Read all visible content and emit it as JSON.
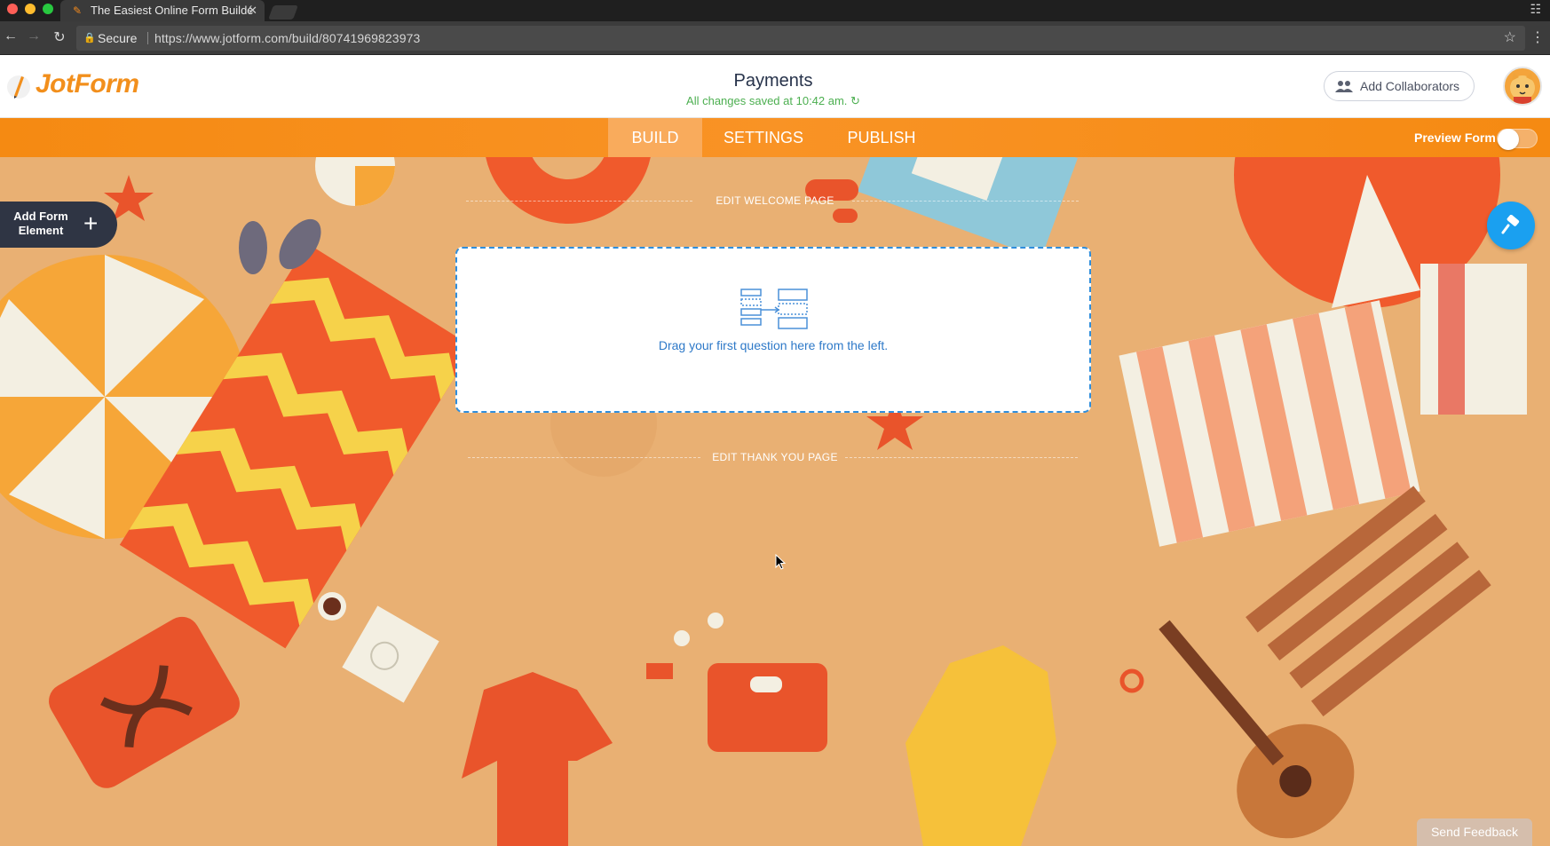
{
  "browser": {
    "tab_title": "The Easiest Online Form Buildé",
    "tab_close": "✕",
    "secure_label": "Secure",
    "url": "https://www.jotform.com/build/80741969823973"
  },
  "header": {
    "logo_text": "JotForm",
    "form_title": "Payments",
    "save_status": "All changes saved at 10:42 am.",
    "collaborators_button": "Add Collaborators"
  },
  "toolbar": {
    "tabs": [
      {
        "label": "BUILD",
        "active": true
      },
      {
        "label": "SETTINGS",
        "active": false
      },
      {
        "label": "PUBLISH",
        "active": false
      }
    ],
    "preview_label": "Preview Form",
    "preview_enabled": false
  },
  "builder": {
    "add_element_label": "Add Form Element",
    "add_element_icon": "+",
    "edit_welcome": "EDIT WELCOME PAGE",
    "dropzone_text": "Drag your first question here from the left.",
    "edit_thanks": "EDIT THANK YOU PAGE",
    "send_feedback": "Send Feedback"
  },
  "colors": {
    "brand_orange": "#f58a12",
    "active_tab": "#f9ab5c",
    "dropzone_border": "#2f8edc",
    "fab_blue": "#1aa0f0",
    "saved_green": "#4caf50"
  }
}
